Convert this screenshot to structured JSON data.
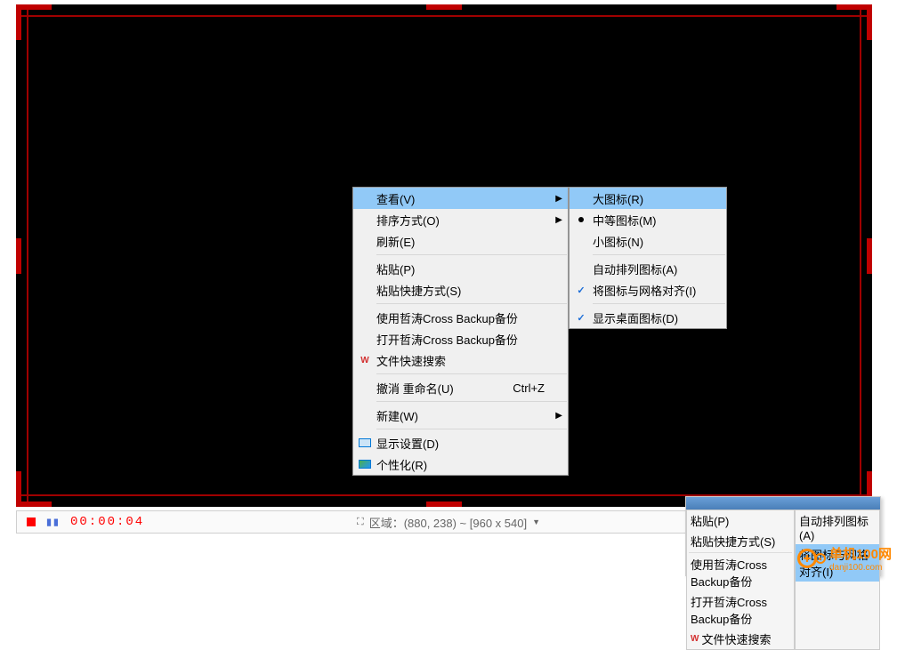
{
  "menu_main": {
    "view": "查看(V)",
    "sort": "排序方式(O)",
    "refresh": "刷新(E)",
    "paste": "粘贴(P)",
    "paste_shortcut": "粘贴快捷方式(S)",
    "backup1": "使用哲涛Cross Backup备份",
    "backup2": "打开哲涛Cross Backup备份",
    "filesearch": "文件快速搜索",
    "undo": "撤消 重命名(U)",
    "undo_sc": "Ctrl+Z",
    "new": "新建(W)",
    "display": "显示设置(D)",
    "personalize": "个性化(R)"
  },
  "menu_sub": {
    "large": "大图标(R)",
    "medium": "中等图标(M)",
    "small": "小图标(N)",
    "auto_arrange": "自动排列图标(A)",
    "align_grid": "将图标与网格对齐(I)",
    "show_desktop": "显示桌面图标(D)"
  },
  "toolbar": {
    "timer": "00:00:04",
    "region_label": "区域：(880, 238) ~ [960 x 540]"
  },
  "thumb": {
    "paste": "粘贴(P)",
    "paste_shortcut": "粘贴快捷方式(S)",
    "backup1": "使用哲涛Cross Backup备份",
    "backup2": "打开哲涛Cross Backup备份",
    "filesearch": "文件快速搜索",
    "auto_arrange": "自动排列图标(A)",
    "align_grid": "将图标与网格对齐(I)"
  },
  "watermark": {
    "top": "单机100网",
    "bottom": "danji100.com"
  }
}
